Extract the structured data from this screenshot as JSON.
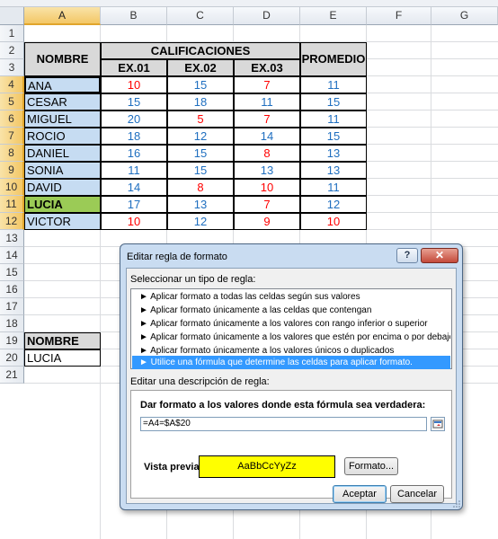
{
  "columns": [
    "A",
    "B",
    "C",
    "D",
    "E",
    "F",
    "G"
  ],
  "rows": [
    "1",
    "2",
    "3",
    "4",
    "5",
    "6",
    "7",
    "8",
    "9",
    "10",
    "11",
    "12",
    "13",
    "14",
    "15",
    "16",
    "17",
    "18",
    "19",
    "20",
    "21"
  ],
  "table": {
    "group_header": "CALIFICACIONES",
    "name_header": "NOMBRE",
    "avg_header": "PROMEDIO",
    "exam_headers": [
      "EX.01",
      "EX.02",
      "EX.03"
    ],
    "students": [
      {
        "name": "ANA",
        "scores": [
          "10",
          "15",
          "7"
        ],
        "avg": "11"
      },
      {
        "name": "CESAR",
        "scores": [
          "15",
          "18",
          "11"
        ],
        "avg": "15"
      },
      {
        "name": "MIGUEL",
        "scores": [
          "20",
          "5",
          "7"
        ],
        "avg": "11"
      },
      {
        "name": "ROCIO",
        "scores": [
          "18",
          "12",
          "14"
        ],
        "avg": "15"
      },
      {
        "name": "DANIEL",
        "scores": [
          "16",
          "15",
          "8"
        ],
        "avg": "13"
      },
      {
        "name": "SONIA",
        "scores": [
          "11",
          "15",
          "13"
        ],
        "avg": "13"
      },
      {
        "name": "DAVID",
        "scores": [
          "14",
          "8",
          "10"
        ],
        "avg": "11"
      },
      {
        "name": "LUCIA",
        "scores": [
          "17",
          "13",
          "7"
        ],
        "avg": "12"
      },
      {
        "name": "VICTOR",
        "scores": [
          "10",
          "12",
          "9"
        ],
        "avg": "10"
      }
    ]
  },
  "lookup": {
    "header": "NOMBRE",
    "value": "LUCIA"
  },
  "colors": {
    "fail_red": "#ff0000",
    "pass_blue": "#1f6fc0",
    "name_fill": "#c6dcf2",
    "highlight_green": "#9bcb56",
    "preview_yellow": "#ffff00"
  },
  "dialog": {
    "title": "Editar regla de formato",
    "help": "?",
    "close": "✕",
    "select_rule_label": "Seleccionar un tipo de regla:",
    "rules": [
      "► Aplicar formato a todas las celdas según sus valores",
      "► Aplicar formato únicamente a las celdas que contengan",
      "► Aplicar formato únicamente a los valores con rango inferior o superior",
      "► Aplicar formato únicamente a los valores que estén por encima o por debajo del promedio",
      "► Aplicar formato únicamente a los valores únicos o duplicados",
      "► Utilice una fórmula que determine las celdas para aplicar formato."
    ],
    "edit_desc_label": "Editar una descripción de regla:",
    "formula_label": "Dar formato a los valores donde esta fórmula sea verdadera:",
    "formula_value": "=A4=$A$20",
    "preview_label": "Vista previa:",
    "preview_text": "AaBbCcYyZz",
    "format_button": "Formato...",
    "ok_button": "Aceptar",
    "cancel_button": "Cancelar"
  }
}
